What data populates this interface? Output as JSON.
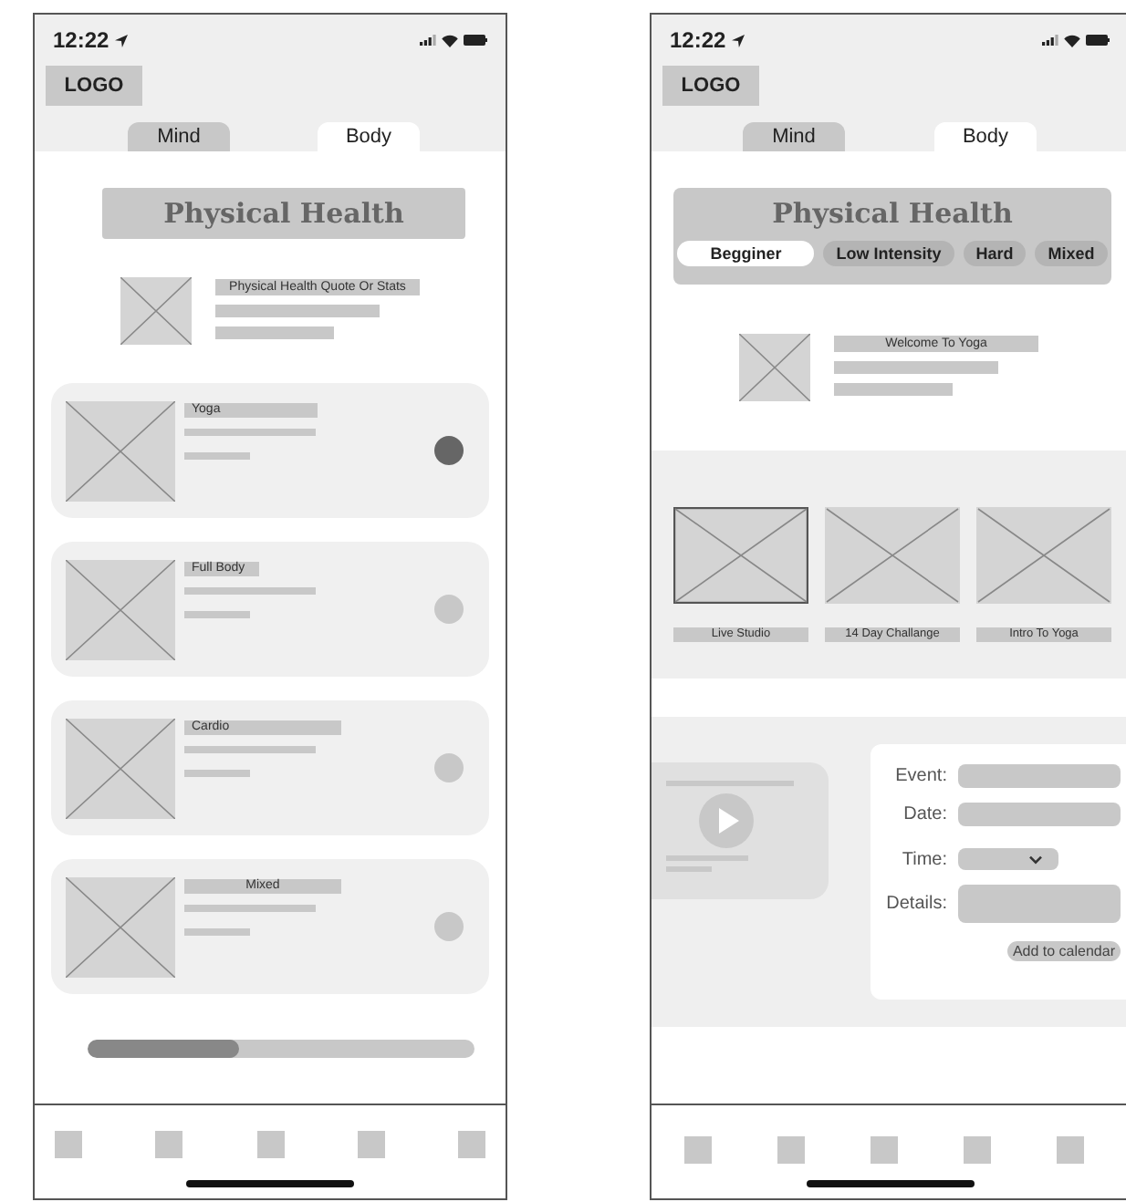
{
  "screens": [
    {
      "status_time": "12:22",
      "logo": "LOGO",
      "tabs": [
        {
          "label": "Mind",
          "selected": false
        },
        {
          "label": "Body",
          "selected": true
        }
      ],
      "title": "Physical Health",
      "intro": {
        "label": "Physical Health Quote Or Stats"
      },
      "cards": [
        {
          "label": "Yoga",
          "selected": true
        },
        {
          "label": "Full Body",
          "selected": false
        },
        {
          "label": "Cardio",
          "selected": false
        },
        {
          "label": "Mixed",
          "selected": false
        }
      ],
      "progress": {
        "level": 0.39
      }
    },
    {
      "status_time": "12:22",
      "logo": "LOGO",
      "tabs": [
        {
          "label": "Mind",
          "selected": false
        },
        {
          "label": "Body",
          "selected": true
        }
      ],
      "title": "Physical Health",
      "filters": [
        {
          "label": "Begginer",
          "selected": true
        },
        {
          "label": "Low Intensity",
          "selected": false
        },
        {
          "label": "Hard",
          "selected": false
        },
        {
          "label": "Mixed",
          "selected": false
        }
      ],
      "intro": {
        "label": "Welcome To Yoga"
      },
      "programs": [
        {
          "label": "Live Studio",
          "selected": true
        },
        {
          "label": "14 Day Challange",
          "selected": false
        },
        {
          "label": "Intro To Yoga",
          "selected": false
        }
      ],
      "event_form": {
        "fields": [
          {
            "kind": "text",
            "label": "Event:"
          },
          {
            "kind": "text",
            "label": "Date:"
          },
          {
            "kind": "select",
            "label": "Time:"
          },
          {
            "kind": "textarea",
            "label": "Details:"
          }
        ],
        "button": "Add to calendar"
      }
    }
  ]
}
